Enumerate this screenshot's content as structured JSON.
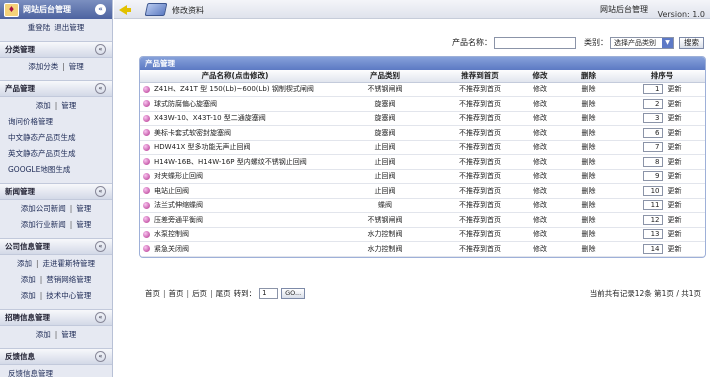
{
  "sidebar": {
    "title": "网站后台管理",
    "top_links": [
      "重登陆",
      "退出管理"
    ],
    "sections": [
      {
        "title": "分类管理",
        "rows": [
          [
            "添加分类",
            "管理"
          ]
        ]
      },
      {
        "title": "产品管理",
        "rows": [
          [
            "添加",
            "管理"
          ],
          [
            "询问价格管理"
          ],
          [
            "中文静态产品页生成"
          ],
          [
            "英文静态产品页生成"
          ],
          [
            "GOOGLE地图生成"
          ]
        ]
      },
      {
        "title": "新闻管理",
        "rows": [
          [
            "添加公司新闻",
            "管理"
          ],
          [
            "添加行业新闻",
            "管理"
          ]
        ]
      },
      {
        "title": "公司信息管理",
        "rows": [
          [
            "添加",
            "走进霍斯特管理"
          ],
          [
            "添加",
            "营销网络管理"
          ],
          [
            "添加",
            "技术中心管理"
          ]
        ]
      },
      {
        "title": "招聘信息管理",
        "rows": [
          [
            "添加",
            "管理"
          ]
        ]
      },
      {
        "title": "反馈信息",
        "rows": [
          [
            "反馈信息管理"
          ]
        ]
      }
    ]
  },
  "topbar": {
    "breadcrumb": "修改资料",
    "app_title": "网站后台管理",
    "version": "Version: 1.0"
  },
  "search": {
    "name_label": "产品名称：",
    "name_value": "",
    "category_label": "类别：",
    "category_selected": "选择产品类别",
    "search_button": "搜索"
  },
  "panel": {
    "title": "产品管理",
    "columns": [
      "产品名称(点击修改)",
      "产品类别",
      "推荐到首页",
      "修改",
      "删除",
      "排序号"
    ],
    "update_label": "更新",
    "rows": [
      {
        "name": "Z41H、Z41T 型 150(Lb)~600(Lb) 钢制楔式闸阀",
        "category": "不锈钢闸阀",
        "recommend": "不推荐到首页",
        "edit": "修改",
        "delete": "删除",
        "order": "1"
      },
      {
        "name": "球式防腐偏心旋塞阀",
        "category": "旋塞阀",
        "recommend": "不推荐到首页",
        "edit": "修改",
        "delete": "删除",
        "order": "2"
      },
      {
        "name": "X43W-10、X43T-10 型二通旋塞阀",
        "category": "旋塞阀",
        "recommend": "不推荐到首页",
        "edit": "修改",
        "delete": "删除",
        "order": "3"
      },
      {
        "name": "美标卡套式软密封旋塞阀",
        "category": "旋塞阀",
        "recommend": "不推荐到首页",
        "edit": "修改",
        "delete": "删除",
        "order": "6"
      },
      {
        "name": "HDW41X 型多功能无声止回阀",
        "category": "止回阀",
        "recommend": "不推荐到首页",
        "edit": "修改",
        "delete": "删除",
        "order": "7"
      },
      {
        "name": "H14W-16B、H14W-16P 型内螺纹不锈钢止回阀",
        "category": "止回阀",
        "recommend": "不推荐到首页",
        "edit": "修改",
        "delete": "删除",
        "order": "8"
      },
      {
        "name": "对夹蝶形止回阀",
        "category": "止回阀",
        "recommend": "不推荐到首页",
        "edit": "修改",
        "delete": "删除",
        "order": "9"
      },
      {
        "name": "电站止回阀",
        "category": "止回阀",
        "recommend": "不推荐到首页",
        "edit": "修改",
        "delete": "删除",
        "order": "10"
      },
      {
        "name": "法兰式伸缩蝶阀",
        "category": "蝶阀",
        "recommend": "不推荐到首页",
        "edit": "修改",
        "delete": "删除",
        "order": "11"
      },
      {
        "name": "压差旁通平衡阀",
        "category": "不锈钢闸阀",
        "recommend": "不推荐到首页",
        "edit": "修改",
        "delete": "删除",
        "order": "12"
      },
      {
        "name": "水泵控制阀",
        "category": "水力控制阀",
        "recommend": "不推荐到首页",
        "edit": "修改",
        "delete": "删除",
        "order": "13"
      },
      {
        "name": "紧急关闭阀",
        "category": "水力控制阀",
        "recommend": "不推荐到首页",
        "edit": "修改",
        "delete": "删除",
        "order": "14"
      }
    ]
  },
  "pager": {
    "first": "首页",
    "prev": "首页",
    "next": "后页",
    "last": "尾页",
    "goto_label": "转到：",
    "page_value": "1",
    "go_button": "GO...",
    "info": "当前共有记录12条   第1页 / 共1页"
  }
}
